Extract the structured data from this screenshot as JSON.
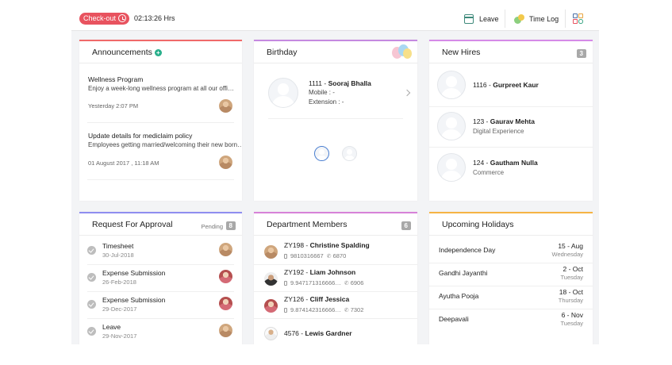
{
  "topbar": {
    "checkout_label": "Check-out",
    "timer": "02:13:26 Hrs",
    "leave_label": "Leave",
    "timelog_label": "Time Log"
  },
  "announcements": {
    "title": "Announcements",
    "items": [
      {
        "title": "Wellness Program",
        "desc": "Enjoy a week-long wellness program at all our offi…",
        "time": "Yesterday 2:07 PM"
      },
      {
        "title": "Update details for mediclaim policy",
        "desc": "Employees getting married/welcoming their new born…",
        "time": "01 August 2017 , 11:18 AM"
      }
    ]
  },
  "birthday": {
    "title": "Birthday",
    "id": "1111 - ",
    "name": "Sooraj Bhalla",
    "mobile": "Mobile : -",
    "extension": "Extension : -"
  },
  "new_hires": {
    "title": "New Hires",
    "count": "3",
    "items": [
      {
        "id": "1116 - ",
        "name": "Gurpreet Kaur",
        "dept": ""
      },
      {
        "id": "123 - ",
        "name": "Gaurav Mehta",
        "dept": "Digital Experience"
      },
      {
        "id": "124 - ",
        "name": "Gautham Nulla",
        "dept": "Commerce"
      }
    ]
  },
  "approval": {
    "title": "Request For Approval",
    "pending_label": "Pending",
    "count": "8",
    "items": [
      {
        "title": "Timesheet",
        "date": "30-Jul-2018"
      },
      {
        "title": "Expense Submission",
        "date": "26-Feb-2018"
      },
      {
        "title": "Expense Submission",
        "date": "29-Dec-2017"
      },
      {
        "title": "Leave",
        "date": "29-Nov-2017"
      }
    ]
  },
  "department": {
    "title": "Department Members",
    "count": "6",
    "items": [
      {
        "id": "ZY198 - ",
        "name": "Christine Spalding",
        "mobile": "9810316667",
        "ext": "6870"
      },
      {
        "id": "ZY192 - ",
        "name": "Liam Johnson",
        "mobile": "9.947171316666…",
        "ext": "6906"
      },
      {
        "id": "ZY126 - ",
        "name": "Cliff Jessica",
        "mobile": "9.874142316666…",
        "ext": "7302"
      },
      {
        "id": "4576 - ",
        "name": "Lewis Gardner",
        "mobile": "",
        "ext": ""
      }
    ]
  },
  "holidays": {
    "title": "Upcoming Holidays",
    "items": [
      {
        "name": "Independence Day",
        "date": "15 - Aug",
        "day": "Wednesday"
      },
      {
        "name": "Gandhi Jayanthi",
        "date": "2 - Oct",
        "day": "Tuesday"
      },
      {
        "name": "Ayutha Pooja",
        "date": "18 - Oct",
        "day": "Thursday"
      },
      {
        "name": "Deepavali",
        "date": "6 - Nov",
        "day": "Tuesday"
      }
    ]
  },
  "colors": {
    "checkout": "#e8535f",
    "announce_accent": "#f06a6a",
    "birthday_accent": "#c58ae0",
    "newhire_accent": "#d58be8",
    "approval_accent": "#8f8ef0",
    "dept_accent": "#d782d8",
    "holiday_accent": "#f5b444"
  }
}
